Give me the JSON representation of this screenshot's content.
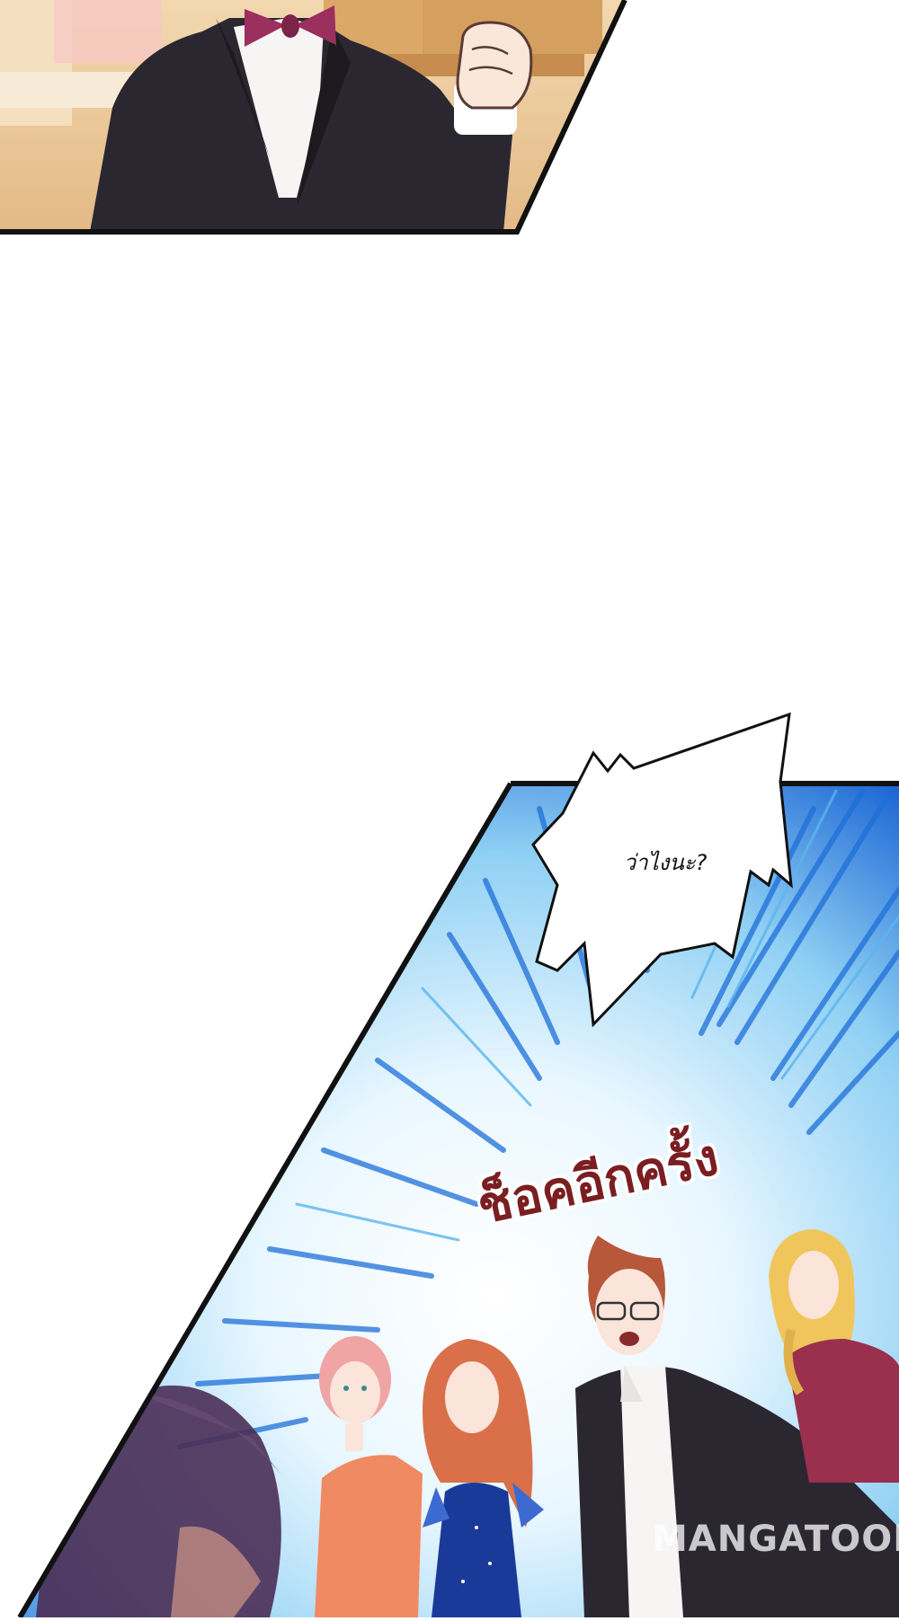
{
  "speech_bubble": {
    "text": "ว่าไงนะ?"
  },
  "sound_effect": {
    "text": "ช็อคอีกครั้ง"
  },
  "watermark": {
    "text": "MANGATOON"
  },
  "colors": {
    "panel_border": "#111111",
    "sfx_text": "#7a1e22",
    "burst_blue": "#1e6fd8",
    "burst_light": "#eaf6ff",
    "suit": "#2b2730",
    "bowtie": "#9b2f5e",
    "background_tan": "#e9c48c"
  }
}
